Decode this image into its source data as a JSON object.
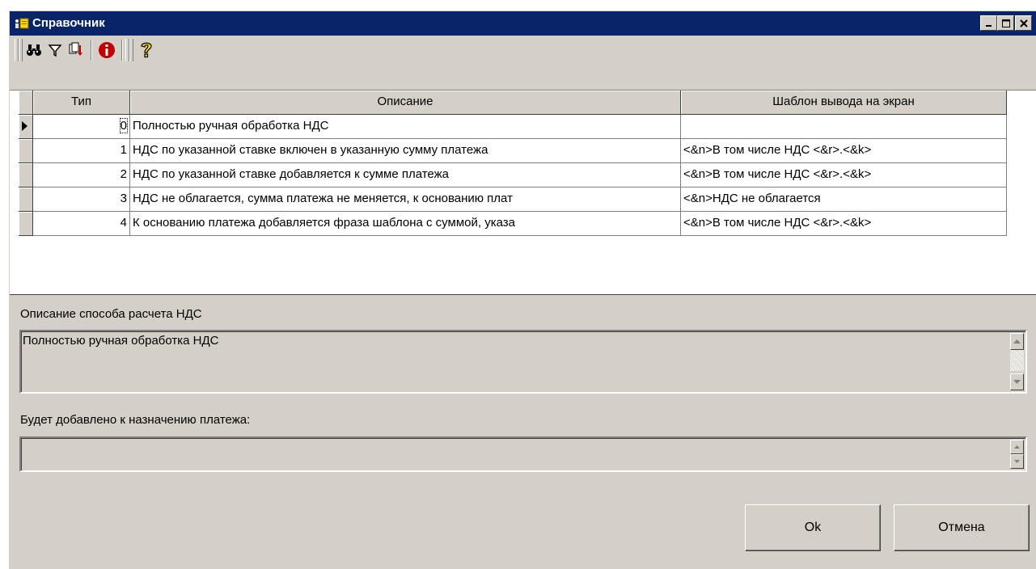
{
  "window": {
    "title": "Справочник"
  },
  "toolbar": {
    "icons": [
      "binoculars-icon",
      "filter-icon",
      "sort-icon",
      "info-icon",
      "help-icon"
    ]
  },
  "grid": {
    "columns": [
      "Тип",
      "Описание",
      "Шаблон вывода на экран"
    ],
    "rows": [
      {
        "type": "0",
        "description": "Полностью ручная обработка НДС",
        "template": ""
      },
      {
        "type": "1",
        "description": "НДС по указанной ставке включен в указанную сумму платежа",
        "template": "<&n>В том числе НДС <&r>.<&k>"
      },
      {
        "type": "2",
        "description": "НДС по указанной ставке добавляется к сумме платежа",
        "template": "<&n>В том числе НДС <&r>.<&k>"
      },
      {
        "type": "3",
        "description": "НДС не облагается, сумма платежа не меняется, к основанию плат",
        "template": "<&n>НДС не облагается"
      },
      {
        "type": "4",
        "description": "К основанию платежа добавляется фраза шаблона с суммой, указа",
        "template": "<&n>В том числе НДС <&r>.<&k>"
      }
    ]
  },
  "description_section": {
    "label": "Описание способа расчета НДС",
    "value": "Полностью ручная обработка НДС"
  },
  "append_section": {
    "label": "Будет добавлено к назначению платежа:",
    "value": ""
  },
  "buttons": {
    "ok": "Ok",
    "cancel": "Отмена"
  }
}
